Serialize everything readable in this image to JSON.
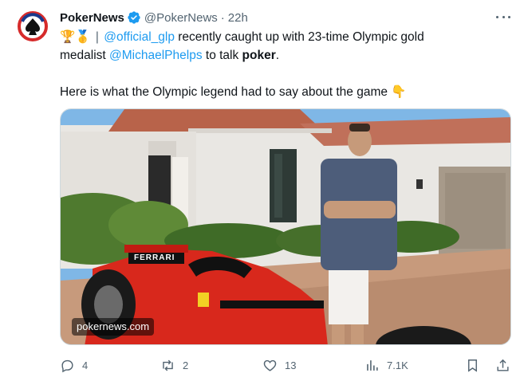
{
  "tweet": {
    "author": {
      "display_name": "PokerNews",
      "handle": "@PokerNews",
      "separator": "·",
      "time": "22h",
      "verified": true,
      "avatar_icon": "pokernews-logo"
    },
    "text": {
      "line1_emoji": "🏆🥇",
      "line1_sep": "|",
      "line1_mention": "@official_glp",
      "line1_rest": " recently caught up with 23-time Olympic gold",
      "line2_prefix": "medalist ",
      "line2_mention": "@MichaelPhelps",
      "line2_middle": " to talk ",
      "line2_bold": "poker",
      "line2_end": ".",
      "line3": "Here is what the Olympic legend had to say about the game 👇"
    },
    "media": {
      "watermark": "pokernews.com",
      "car_wing_text": "FERRARI"
    },
    "actions": {
      "replies": "4",
      "reposts": "2",
      "likes": "13",
      "views": "7.1K"
    },
    "colors": {
      "link": "#1d9bf0",
      "muted": "#536471",
      "verified": "#1d9bf0",
      "ferrari_red": "#d8281c"
    }
  }
}
